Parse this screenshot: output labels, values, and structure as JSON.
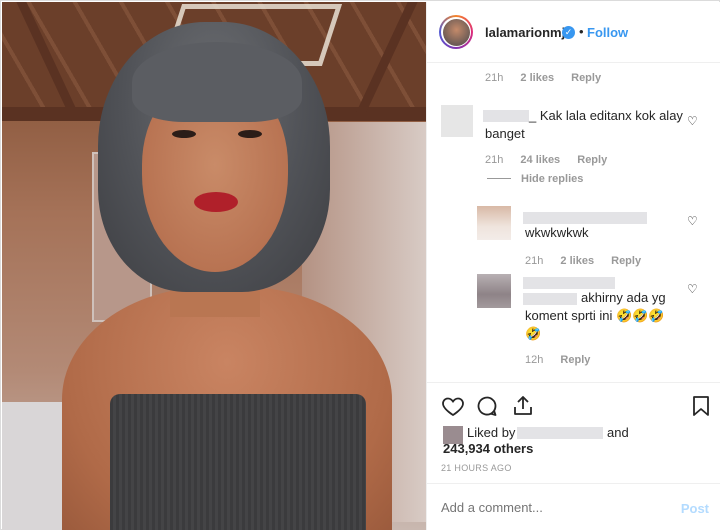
{
  "header": {
    "username": "lalamarionmj",
    "verified": "✓",
    "separator": "•",
    "follow_label": "Follow"
  },
  "comments": [
    {
      "time": "21h",
      "likes": "2 likes",
      "reply": "Reply"
    },
    {
      "text": "_ Kak lala editanx kok alay banget",
      "time": "21h",
      "likes": "24 likes",
      "reply": "Reply",
      "hide_replies": "Hide replies"
    },
    {
      "text": "wkwkwkwk",
      "time": "21h",
      "likes": "2 likes",
      "reply": "Reply"
    },
    {
      "text": "akhirny ada yg koment sprti ini 🤣🤣🤣 🤣",
      "time": "12h",
      "reply": "Reply"
    }
  ],
  "likes": {
    "prefix": "Liked by",
    "and": "and",
    "others": "243,934 others"
  },
  "time_ago": "21 HOURS AGO",
  "add_comment": {
    "placeholder": "Add a comment...",
    "post_label": "Post"
  },
  "colors": {
    "accent": "#3897f0",
    "text": "#262626",
    "muted": "#999999"
  },
  "icons": [
    "heart-icon",
    "comment-icon",
    "share-icon",
    "bookmark-icon",
    "verified-badge-icon"
  ]
}
